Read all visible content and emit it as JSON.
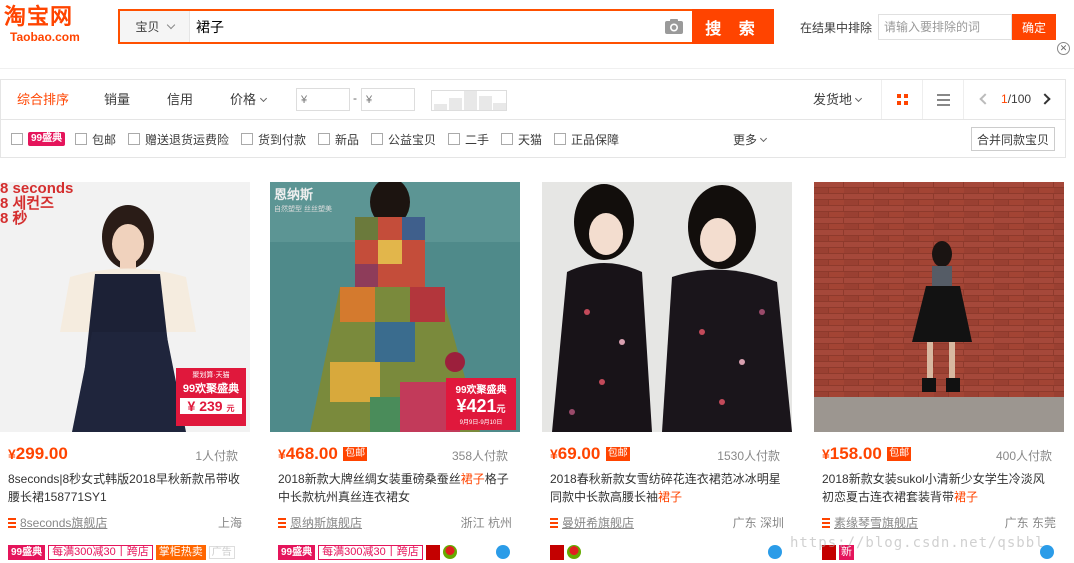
{
  "brand": {
    "logo_cn": "淘宝网",
    "logo_en": "Taobao.com",
    "color": "#ff4400"
  },
  "search": {
    "type": "宝贝",
    "query": "裙子",
    "button": "搜 索"
  },
  "exclude": {
    "label": "在结果中排除",
    "placeholder": "请输入要排除的词",
    "button": "确定"
  },
  "sort": {
    "tabs": [
      "综合排序",
      "销量",
      "信用",
      "价格"
    ],
    "active": "综合排序",
    "price_min_placeholder": "¥",
    "price_max_placeholder": "¥",
    "ship_from": "发货地",
    "page_current": "1",
    "page_total": "/100"
  },
  "filters": {
    "items": [
      "99盛典",
      "包邮",
      "赠送退货运费险",
      "货到付款",
      "新品",
      "公益宝贝",
      "二手",
      "天猫",
      "正品保障"
    ],
    "more": "更多",
    "merge": "合并同款宝贝"
  },
  "products": [
    {
      "yen": "¥",
      "price": "299.00",
      "baoyou": "",
      "payers": "1人付款",
      "title_pre": "8seconds|8秒女式韩版2018早秋新款吊带收腰长裙158771SY1",
      "title_hl": "",
      "title_post": "",
      "shop": "8seconds旗舰店",
      "location": "上海",
      "image_text": {
        "brand": "8 seconds",
        "brand_kr": "8 세컨즈",
        "brand_cn": "8 秒",
        "promo1": "聚划算·天猫",
        "promo2": "99欢聚盛典",
        "promo_price": "239",
        "promo_unit": "元"
      },
      "badges": {
        "b99": "99盛典",
        "promo": "每满300减30丨跨店",
        "hot": "掌柜热卖",
        "ad": "广告"
      }
    },
    {
      "yen": "¥",
      "price": "468.00",
      "baoyou": "包邮",
      "payers": "358人付款",
      "title_pre": "2018新款大牌丝绸女装重磅桑蚕丝",
      "title_hl": "裙子",
      "title_post": "格子中长款杭州真丝连衣裙女",
      "shop": "恩纳斯旗舰店",
      "location": "浙江 杭州",
      "image_text": {
        "brand": "恩纳斯",
        "sub": "自然塑型 丝丝塑美",
        "promo1": "99欢聚盛典",
        "promo_price": "421",
        "promo_unit": "元",
        "promo_date": "9月9日-9月10日"
      },
      "badges": {
        "b99": "99盛典",
        "promo": "每满300减30丨跨店"
      }
    },
    {
      "yen": "¥",
      "price": "69.00",
      "baoyou": "包邮",
      "payers": "1530人付款",
      "title_pre": "2018春秋新款女雪纺碎花连衣裙范冰冰明星同款中长款高腰长袖",
      "title_hl": "裙子",
      "title_post": "",
      "shop": "曼妍希旗舰店",
      "location": "广东 深圳",
      "badges": {}
    },
    {
      "yen": "¥",
      "price": "158.00",
      "baoyou": "包邮",
      "payers": "400人付款",
      "title_pre": "2018新款女装sukol小清新少女学生冷淡风初恋夏古连衣裙套装背带",
      "title_hl": "裙子",
      "title_post": "",
      "shop": "素缘琴雪旗舰店",
      "location": "广东 东莞",
      "badges": {
        "new": "新"
      }
    }
  ],
  "watermark": "https://blog.csdn.net/qsbbl"
}
